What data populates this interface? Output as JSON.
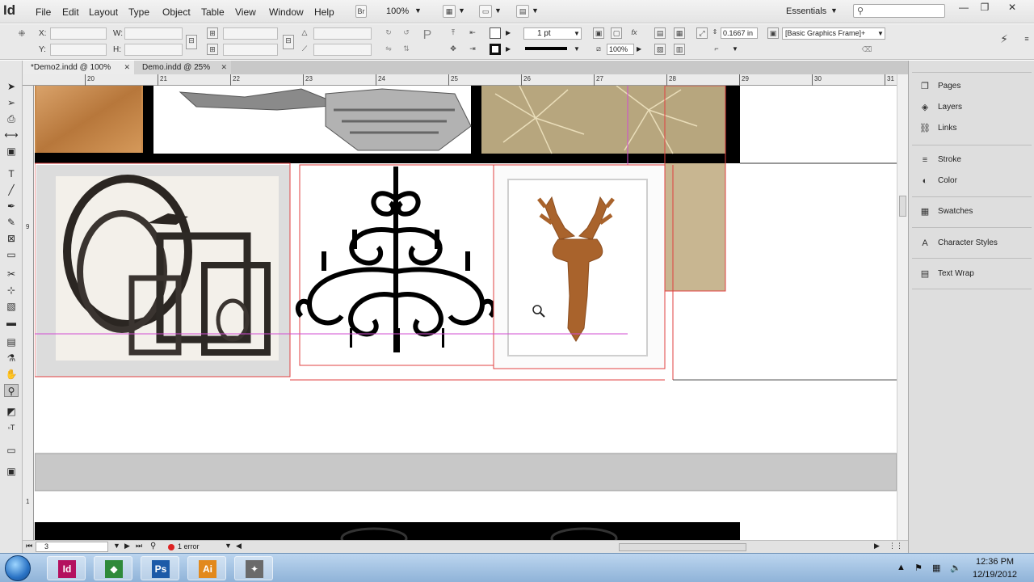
{
  "menubar": {
    "app_logo": "Id",
    "items": [
      "File",
      "Edit",
      "Layout",
      "Type",
      "Object",
      "Table",
      "View",
      "Window",
      "Help"
    ],
    "zoom": "100%",
    "workspace": "Essentials",
    "search_placeholder": ""
  },
  "control": {
    "x_label": "X:",
    "y_label": "Y:",
    "w_label": "W:",
    "h_label": "H:",
    "stroke_weight": "1 pt",
    "scale": "100%",
    "gap": "0.1667 in",
    "object_style": "[Basic Graphics Frame]+"
  },
  "tabs": [
    {
      "label": "*Demo2.indd @ 100%"
    },
    {
      "label": "Demo.indd @ 25%"
    }
  ],
  "ruler": {
    "h_ticks": [
      "20",
      "21",
      "22",
      "23",
      "24",
      "25",
      "26",
      "27",
      "28",
      "29",
      "30",
      "31"
    ],
    "v_ticks": [
      "9",
      "1"
    ]
  },
  "status": {
    "page": "3",
    "preflight": "1 error"
  },
  "panels": {
    "items": [
      "Pages",
      "Layers",
      "Links",
      "Stroke",
      "Color",
      "Swatches",
      "Character Styles",
      "Text Wrap"
    ]
  },
  "taskbar": {
    "apps": [
      {
        "glyph": "Id",
        "color": "#b4115f"
      },
      {
        "glyph": "",
        "color": "#2f8a3a"
      },
      {
        "glyph": "Ps",
        "color": "#1c5aa8"
      },
      {
        "glyph": "Ai",
        "color": "#e2891c"
      },
      {
        "glyph": "",
        "color": "#6a6a6a"
      }
    ],
    "time": "12:36 PM",
    "date": "12/19/2012"
  },
  "colors": {
    "frame_red": "#e04040",
    "guide_magenta": "#d24bd2",
    "banner_black": "#000000",
    "band_gray": "#c8c8c8",
    "deer_brown": "#a9632c"
  }
}
